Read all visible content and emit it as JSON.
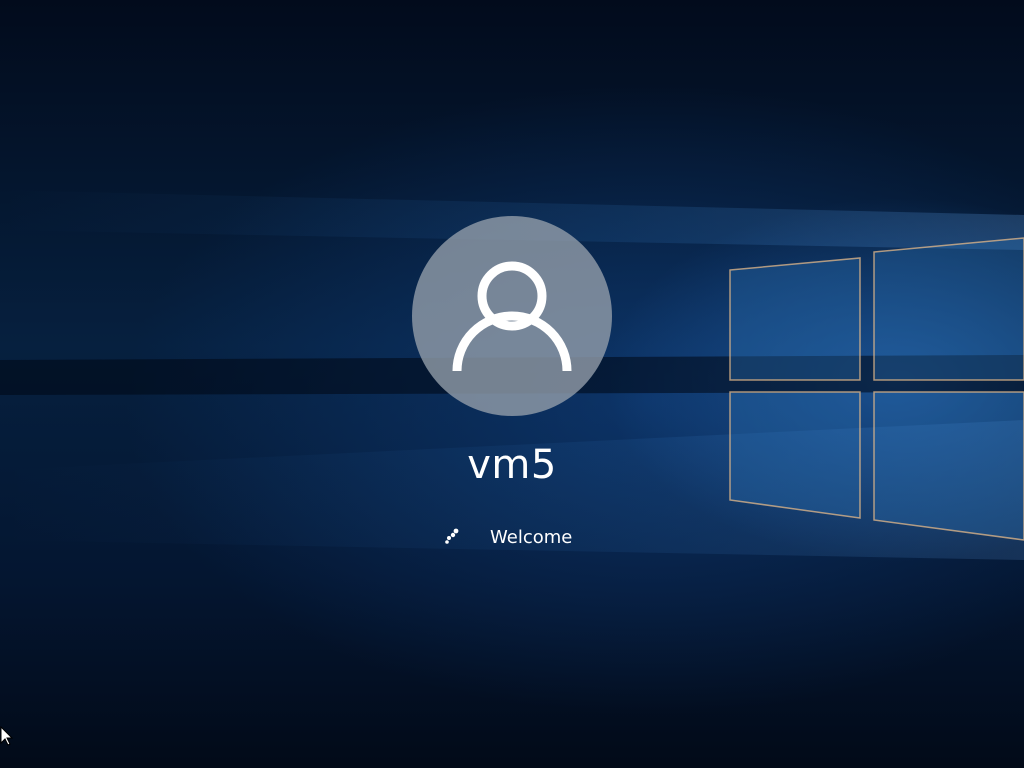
{
  "login": {
    "username": "vm5",
    "status_text": "Welcome"
  },
  "icons": {
    "avatar": "user-account-icon",
    "spinner": "loading-spinner-icon",
    "cursor": "mouse-pointer-icon"
  },
  "colors": {
    "background_dark": "#031024",
    "accent_blue": "#1f6fc0",
    "avatar_circle": "#96a0ac",
    "text": "#ffffff"
  }
}
